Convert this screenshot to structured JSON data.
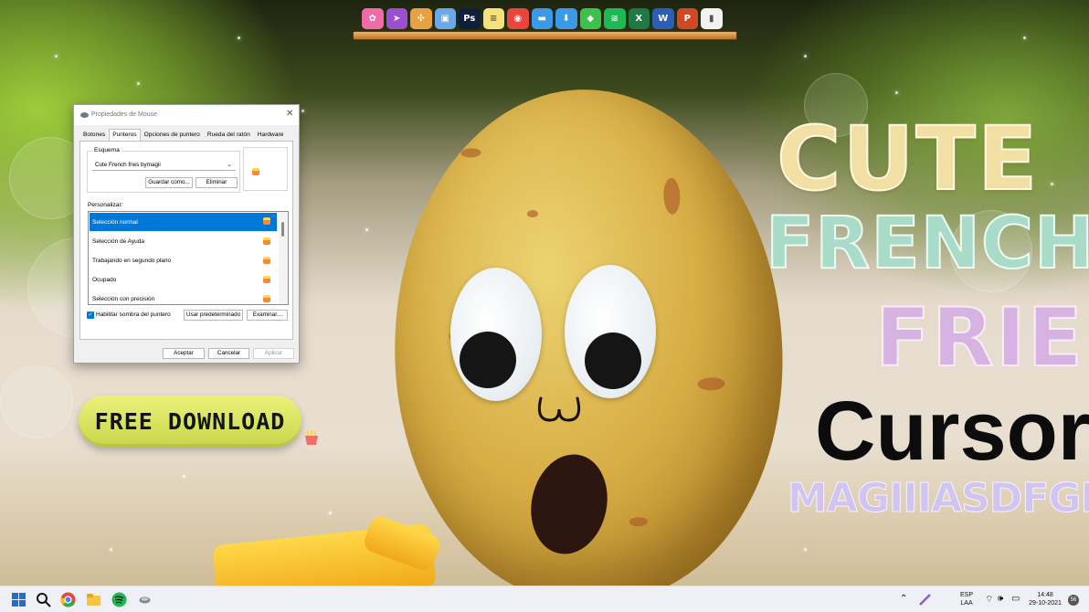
{
  "dialog": {
    "title": "Propiedades de Mouse",
    "tabs": [
      "Botones",
      "Punteros",
      "Opciones de puntero",
      "Rueda del ratón",
      "Hardware"
    ],
    "scheme_label": "Esquema",
    "scheme_value": "Cute French fries bymagii",
    "save_as": "Guardar como...",
    "delete": "Eliminar",
    "customize_label": "Personalizar:",
    "pointers": [
      "Selección normal",
      "Selección de Ayuda",
      "Trabajando en segundo plano",
      "Ocupado",
      "Selección con precisión"
    ],
    "shadow_label": "Habilitar sombra del puntero",
    "use_default": "Usar predeterminado",
    "browse": "Examinar...",
    "ok": "Aceptar",
    "cancel": "Cancelar",
    "apply": "Aplicar"
  },
  "promo": {
    "free_download": "FREE DOWNLOAD",
    "line1": "CUTE",
    "line2": "FRENCH",
    "line3": "FRIES",
    "line4": "Cursor",
    "line5": "MAGIIIASDFGHJKL"
  },
  "dock": {
    "icons": [
      {
        "name": "flower-app-icon",
        "color": "#f06aa8",
        "glyph": "✿"
      },
      {
        "name": "cursor-app-icon",
        "color": "#9b4fd0",
        "glyph": "➤"
      },
      {
        "name": "pinwheel-app-icon",
        "color": "#e8a040",
        "glyph": "✣"
      },
      {
        "name": "photos-app-icon",
        "color": "#6aa8e8",
        "glyph": "▣"
      },
      {
        "name": "photoshop-icon",
        "color": "#0d1f3a",
        "glyph": "Ps"
      },
      {
        "name": "notes-icon",
        "color": "#f5e27a",
        "glyph": "≡"
      },
      {
        "name": "chrome-icon",
        "color": "#e8453c",
        "glyph": "◉"
      },
      {
        "name": "folder-icon",
        "color": "#3a9ae8",
        "glyph": "▬"
      },
      {
        "name": "downloads-icon",
        "color": "#3a9ae8",
        "glyph": "⬇"
      },
      {
        "name": "sims-icon",
        "color": "#3cc24a",
        "glyph": "◆"
      },
      {
        "name": "spotify-icon",
        "color": "#1db954",
        "glyph": "≋"
      },
      {
        "name": "excel-icon",
        "color": "#1d7a45",
        "glyph": "X"
      },
      {
        "name": "word-icon",
        "color": "#2b5eb8",
        "glyph": "W"
      },
      {
        "name": "powerpoint-icon",
        "color": "#d24726",
        "glyph": "P"
      },
      {
        "name": "trash-icon",
        "color": "#f2f2f2",
        "glyph": "▮"
      }
    ]
  },
  "taskbar": {
    "language": "ESP",
    "layout": "LAA",
    "time": "14:48",
    "date": "29-10-2021",
    "badge": "56"
  }
}
